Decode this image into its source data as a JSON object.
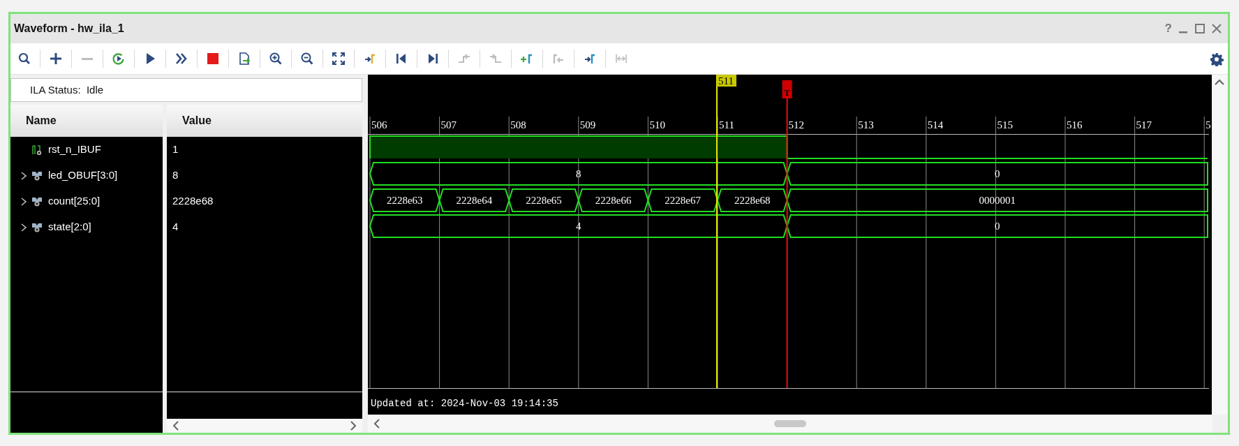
{
  "window": {
    "title": "Waveform - hw_ila_1",
    "help": "?"
  },
  "toolbar": [
    {
      "kind": "search",
      "disabled": false
    },
    {
      "kind": "add",
      "disabled": false
    },
    {
      "kind": "remove",
      "disabled": true
    },
    {
      "kind": "run-trigger",
      "disabled": false
    },
    {
      "kind": "run",
      "disabled": false
    },
    {
      "kind": "run-immediate",
      "disabled": false
    },
    {
      "kind": "stop",
      "disabled": false
    },
    {
      "kind": "export",
      "disabled": false
    },
    {
      "kind": "zoom-in",
      "disabled": false
    },
    {
      "kind": "zoom-out",
      "disabled": false
    },
    {
      "kind": "zoom-fit",
      "disabled": false
    },
    {
      "kind": "go-to-cursor",
      "disabled": false
    },
    {
      "kind": "go-to-start",
      "disabled": false
    },
    {
      "kind": "go-to-end",
      "disabled": false
    },
    {
      "kind": "prev-transition",
      "disabled": true
    },
    {
      "kind": "next-transition",
      "disabled": true
    },
    {
      "kind": "add-marker",
      "disabled": false
    },
    {
      "kind": "prev-marker",
      "disabled": true
    },
    {
      "kind": "next-marker",
      "disabled": false
    },
    {
      "kind": "swap-cursors",
      "disabled": true
    }
  ],
  "ila_status": "ILA Status:  Idle",
  "columns": [
    "Name",
    "Value"
  ],
  "signals": [
    {
      "name": "rst_n_IBUF",
      "kind": "bit",
      "value": "1"
    },
    {
      "name": "led_OBUF[3:0]",
      "kind": "bus",
      "expanded": false,
      "value": "8",
      "segments": [
        "8",
        "0"
      ]
    },
    {
      "name": "count[25:0]",
      "kind": "bus",
      "expanded": false,
      "value": "2228e68",
      "segments": [
        "2228e63",
        "2228e64",
        "2228e65",
        "2228e66",
        "2228e67",
        "2228e68",
        "0000001"
      ]
    },
    {
      "name": "state[2:0]",
      "kind": "bus",
      "expanded": false,
      "value": "4",
      "segments": [
        "4",
        "0"
      ]
    }
  ],
  "waveform": {
    "ticks": [
      "506",
      "507",
      "508",
      "509",
      "510",
      "511",
      "512",
      "513",
      "514",
      "515",
      "516",
      "517",
      "5"
    ],
    "cursor": "511",
    "trigger": "T",
    "updated": "Updated at: 2024-Nov-03 19:14:35"
  }
}
